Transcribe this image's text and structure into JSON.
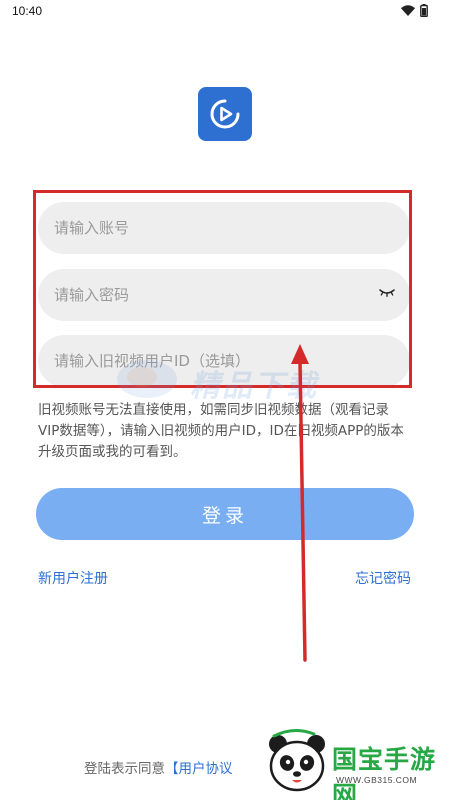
{
  "status_bar": {
    "time": "10:40",
    "icons": [
      "wifi-icon",
      "battery-icon"
    ]
  },
  "app": {
    "logo_icon": "play-icon",
    "brand_color": "#2e6fd2"
  },
  "form": {
    "account_placeholder": "请输入账号",
    "password_placeholder": "请输入密码",
    "password_icon": "eye-closed-icon",
    "old_id_placeholder": "请输入旧视频用户ID（选填）",
    "hint": "旧视频账号无法直接使用，如需同步旧视频数据（观看记录 VIP数据等），请输入旧视频的用户ID，ID在旧视频APP的版本升级页面或我的可看到。",
    "login_label": "登录",
    "login_color": "#7aaef3"
  },
  "links": {
    "register": "新用户注册",
    "forgot": "忘记密码"
  },
  "agreement": {
    "prefix": "登陆表示同意",
    "link": "【用户协议"
  },
  "annotation": {
    "color": "#d42a2a"
  },
  "watermark": {
    "text": "精品下载"
  },
  "brand_badge": {
    "name": "国宝手游网",
    "url": "WWW.GB315.COM",
    "color": "#27a844"
  }
}
